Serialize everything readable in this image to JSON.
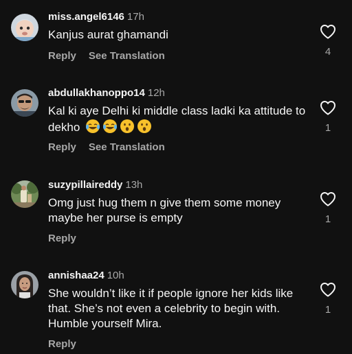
{
  "actions": {
    "reply_label": "Reply",
    "translate_label": "See Translation"
  },
  "colors": {
    "background": "#111111",
    "text": "#f5f5f5",
    "muted": "#a8a8a8",
    "emoji_face": "#f7c12b"
  },
  "comments": [
    {
      "username": "miss.angel6146",
      "time": "17h",
      "text": "Kanjus aurat ghamandi",
      "likes": "4",
      "avatar_icon": "baby-photo-avatar"
    },
    {
      "username": "abdullakhanoppo14",
      "time": "12h",
      "text": "Kal ki aye Delhi ki middle class ladki ka attitude to dekho",
      "emojis": [
        "face-with-tears-of-joy-icon",
        "face-with-tears-of-joy-icon",
        "hushed-face-icon",
        "hushed-face-icon"
      ],
      "likes": "1",
      "avatar_icon": "man-with-sunglasses-avatar"
    },
    {
      "username": "suzypillaireddy",
      "time": "13h",
      "text": "Omg just hug them n give them some money maybe her purse is empty",
      "likes": "1",
      "avatar_icon": "outdoor-photo-avatar"
    },
    {
      "username": "annishaa24",
      "time": "10h",
      "text": "She wouldn’t like it if people ignore her kids like that. She’s not even a celebrity to begin with. Humble yourself Mira.",
      "likes": "1",
      "avatar_icon": "woman-portrait-avatar"
    }
  ]
}
